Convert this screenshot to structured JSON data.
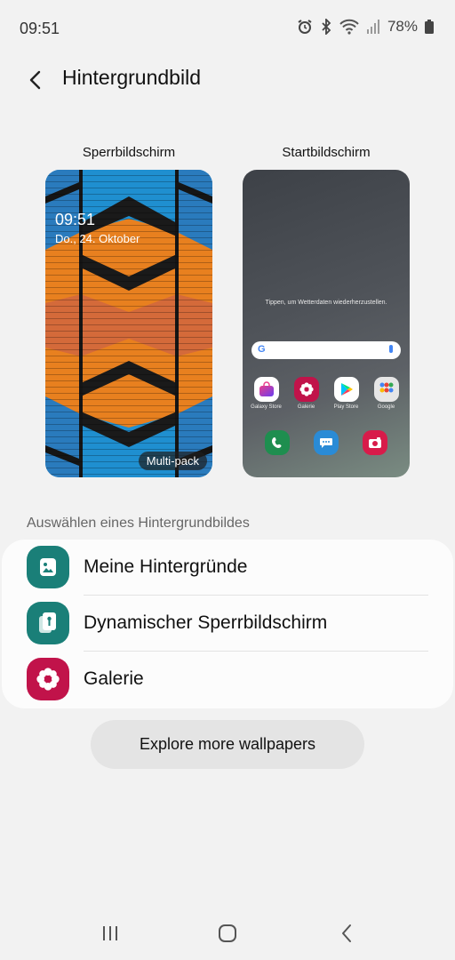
{
  "status_bar": {
    "time": "09:51",
    "battery": "78%"
  },
  "app_bar": {
    "title": "Hintergrundbild"
  },
  "previews": {
    "lock_label": "Sperrbildschirm",
    "home_label": "Startbildschirm",
    "lock_time": "09:51",
    "lock_date": "Do., 24. Oktober",
    "lock_badge": "Multi-pack",
    "home_weather_hint": "Tippen, um Wetterdaten wiederherzustellen.",
    "home_apps": [
      {
        "label": "Galaxy Store",
        "icon": "galaxy-store-icon",
        "color": "#e8eaf0"
      },
      {
        "label": "Galerie",
        "icon": "gallery-flower-icon",
        "color": "#c1134a"
      },
      {
        "label": "Play Store",
        "icon": "play-store-icon",
        "color": "#ffffff"
      },
      {
        "label": "Google",
        "icon": "google-folder-icon",
        "color": "#e8e8e8"
      }
    ],
    "dock": [
      {
        "icon": "phone-icon",
        "color": "#1e8e4f"
      },
      {
        "icon": "messages-icon",
        "color": "#2a8bd6"
      },
      {
        "icon": "camera-icon",
        "color": "#d81b4a"
      }
    ]
  },
  "section": {
    "header": "Auswählen eines Hintergrundbildes",
    "items": [
      {
        "label": "Meine Hintergründe",
        "icon": "my-wallpapers-icon",
        "color": "#1a7f78"
      },
      {
        "label": "Dynamischer Sperrbildschirm",
        "icon": "dynamic-lockscreen-icon",
        "color": "#1a7f78"
      },
      {
        "label": "Galerie",
        "icon": "gallery-flower-icon",
        "color": "#c1134a"
      }
    ]
  },
  "explore_button": "Explore more wallpapers",
  "nav_bar": {
    "recents": "recents-icon",
    "home": "home-icon",
    "back": "back-icon"
  }
}
